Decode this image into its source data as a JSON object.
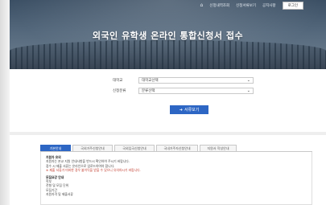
{
  "top_nav": {
    "home_icon": "home-icon",
    "links": [
      "신청내역조회",
      "신청서류보기",
      "공지사항"
    ],
    "login_label": "로그인"
  },
  "hero": {
    "title": "외국인 유학생 온라인 통합신청서 접수"
  },
  "form": {
    "fields": [
      {
        "label": "대학교",
        "value": "대학교선택"
      },
      {
        "label": "신청분류",
        "value": "분류선택"
      }
    ],
    "search_label": "서류보기"
  },
  "tabs": [
    "기본안내",
    "국외거주신청안내",
    "국외입국신청안내",
    "국내거주자신청안내",
    "지원서 작성안내"
  ],
  "notice": {
    "title": "지원자 유의",
    "lines": [
      "지원자는 본교 지원 안내사항을 반드시 확인하여 주시기 바랍니다.",
      "접수 시 제출 서류는 온라인으로 업로드하여야 합니다.",
      "※ 제출 서류가 미비한 경우 불이익을 받을 수 있으니 유의하시기 바랍니다."
    ],
    "section2_title": "모집요강 안내",
    "section2_lines": [
      "학부",
      "전형 및 모집 단위",
      "모집기간",
      "지원자격 및 제출서류"
    ]
  }
}
